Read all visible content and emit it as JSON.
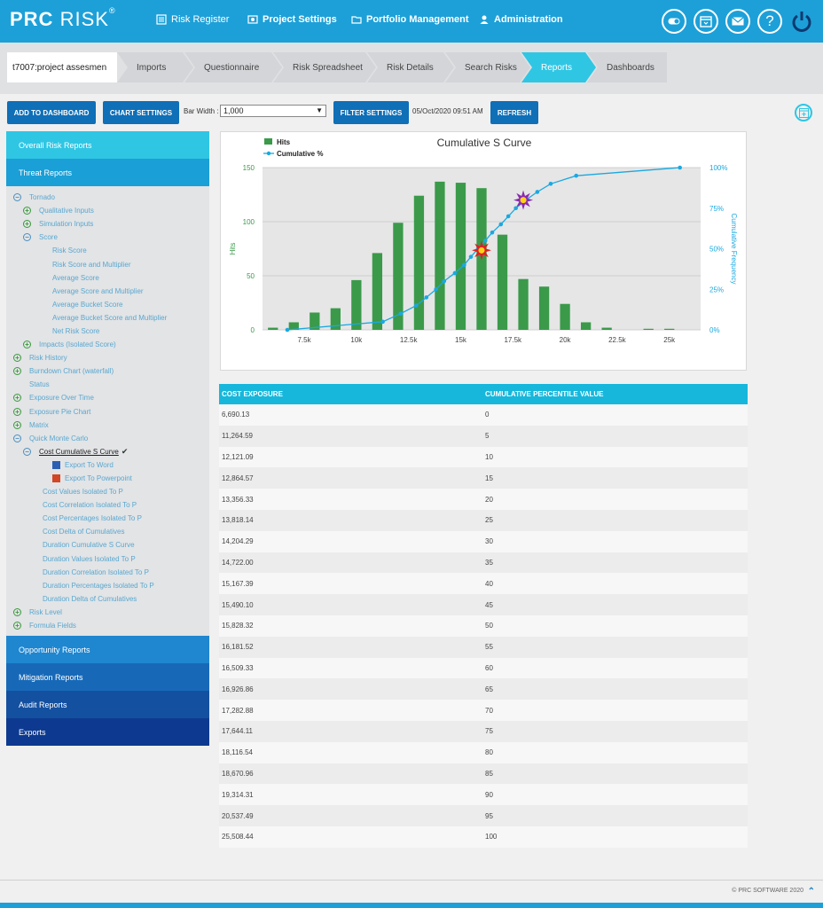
{
  "app": {
    "logo_bold": "PRC",
    "logo_light": "RISK",
    "logo_reg": "®"
  },
  "topnav": [
    {
      "label": "Risk Register",
      "icon": "list-icon"
    },
    {
      "label": "Project Settings",
      "icon": "settings-icon"
    },
    {
      "label": "Portfolio Management",
      "icon": "folder-icon"
    },
    {
      "label": "Administration",
      "icon": "user-icon"
    }
  ],
  "breadcrumb": {
    "project": "t7007:project assesmen",
    "steps": [
      "Imports",
      "Questionnaire",
      "Risk Spreadsheet",
      "Risk Details",
      "Search Risks",
      "Reports",
      "Dashboards"
    ],
    "active": "Reports"
  },
  "toolbar": {
    "add_dashboard": "ADD TO DASHBOARD",
    "chart_settings": "CHART SETTINGS",
    "bar_width_label": "Bar Width :",
    "bar_width_value": "1,000",
    "filter_settings": "FILTER SETTINGS",
    "datetime": "05/Oct/2020 09:51 AM",
    "refresh": "REFRESH"
  },
  "sidebar": {
    "overall": "Overall Risk Reports",
    "threat": "Threat Reports",
    "tree": [
      {
        "label": "Tornado",
        "level": 0,
        "icon": "minus"
      },
      {
        "label": "Qualitative Inputs",
        "level": 1,
        "icon": "plus"
      },
      {
        "label": "Simulation Inputs",
        "level": 1,
        "icon": "plus"
      },
      {
        "label": "Score",
        "level": 1,
        "icon": "minus"
      },
      {
        "label": "Risk Score",
        "level": 2,
        "icon": ""
      },
      {
        "label": "Risk Score and Multiplier",
        "level": 2,
        "icon": ""
      },
      {
        "label": "Average Score",
        "level": 2,
        "icon": ""
      },
      {
        "label": "Average Score and Multiplier",
        "level": 2,
        "icon": ""
      },
      {
        "label": "Average Bucket Score",
        "level": 2,
        "icon": ""
      },
      {
        "label": "Average Bucket Score and Multiplier",
        "level": 2,
        "icon": ""
      },
      {
        "label": "Net Risk Score",
        "level": 2,
        "icon": ""
      },
      {
        "label": "Impacts (Isolated Score)",
        "level": 1,
        "icon": "plus"
      },
      {
        "label": "Risk History",
        "level": 0,
        "icon": "plus"
      },
      {
        "label": "Burndown Chart (waterfall)",
        "level": 0,
        "icon": "plus"
      },
      {
        "label": "Status",
        "level": 0,
        "icon": ""
      },
      {
        "label": "Exposure Over Time",
        "level": 0,
        "icon": "plus"
      },
      {
        "label": "Exposure Pie Chart",
        "level": 0,
        "icon": "plus"
      },
      {
        "label": "Matrix",
        "level": 0,
        "icon": "plus"
      },
      {
        "label": "Quick Monte Carlo",
        "level": 0,
        "icon": "minus"
      },
      {
        "label": "Cost Cumulative S Curve",
        "level": 1,
        "icon": "minus",
        "selected": true
      },
      {
        "label": "Export To Word",
        "level": 2,
        "icon": "word"
      },
      {
        "label": "Export To Powerpoint",
        "level": 2,
        "icon": "ppt"
      },
      {
        "label": "Cost Values Isolated To P",
        "level": 1.5,
        "icon": ""
      },
      {
        "label": "Cost Correlation Isolated To P",
        "level": 1.5,
        "icon": ""
      },
      {
        "label": "Cost Percentages Isolated To P",
        "level": 1.5,
        "icon": ""
      },
      {
        "label": "Cost Delta of Cumulatives",
        "level": 1.5,
        "icon": ""
      },
      {
        "label": "Duration Cumulative S Curve",
        "level": 1.5,
        "icon": ""
      },
      {
        "label": "Duration Values Isolated To P",
        "level": 1.5,
        "icon": ""
      },
      {
        "label": "Duration Correlation Isolated To P",
        "level": 1.5,
        "icon": ""
      },
      {
        "label": "Duration Percentages Isolated To P",
        "level": 1.5,
        "icon": ""
      },
      {
        "label": "Duration Delta of Cumulatives",
        "level": 1.5,
        "icon": ""
      },
      {
        "label": "Risk Level",
        "level": 0,
        "icon": "plus"
      },
      {
        "label": "Formula Fields",
        "level": 0,
        "icon": "plus"
      }
    ],
    "sections": [
      {
        "label": "Opportunity Reports",
        "color": "#1f86d0"
      },
      {
        "label": "Mitigation Reports",
        "color": "#1769b8"
      },
      {
        "label": "Audit Reports",
        "color": "#1450a0"
      },
      {
        "label": "Exports",
        "color": "#0d3a90"
      }
    ]
  },
  "chart_data": {
    "type": "bar",
    "title": "Cumulative S Curve",
    "legend": [
      "Hits",
      "Cumulative %"
    ],
    "legend_position": "top-left",
    "ylabel": "Hits",
    "y2label": "Cumulative Frequency",
    "xticks": [
      "7.5k",
      "10k",
      "12.5k",
      "15k",
      "17.5k",
      "20k",
      "22.5k",
      "25k"
    ],
    "xtick_values": [
      7500,
      10000,
      12500,
      15000,
      17500,
      20000,
      22500,
      25000
    ],
    "yticks": [
      "0",
      "50",
      "100",
      "150"
    ],
    "y2ticks": [
      "0%",
      "25%",
      "50%",
      "75%",
      "100%"
    ],
    "xlim": [
      5500,
      26500
    ],
    "ylim": [
      0,
      150
    ],
    "y2lim": [
      0,
      100
    ],
    "grid": true,
    "bars": {
      "name": "Hits",
      "color": "#3a9a4a",
      "x": [
        6000,
        7000,
        8000,
        9000,
        10000,
        11000,
        12000,
        13000,
        14000,
        15000,
        16000,
        17000,
        18000,
        19000,
        20000,
        21000,
        22000,
        23000,
        24000,
        25000
      ],
      "values": [
        2,
        7,
        16,
        20,
        46,
        71,
        99,
        124,
        137,
        136,
        131,
        88,
        47,
        40,
        24,
        7,
        2,
        0,
        1,
        1
      ]
    },
    "line": {
      "name": "Cumulative %",
      "color": "#1ba8e0",
      "x": [
        6690,
        11265,
        12121,
        12865,
        13356,
        13818,
        14204,
        14722,
        15167,
        15490,
        15828,
        16182,
        16509,
        16927,
        17283,
        17644,
        18117,
        18671,
        19314,
        20537,
        25508
      ],
      "values": [
        0,
        5,
        10,
        15,
        20,
        25,
        30,
        35,
        40,
        45,
        50,
        55,
        60,
        65,
        70,
        75,
        80,
        85,
        90,
        95,
        100
      ]
    },
    "markers": [
      {
        "x": 16000,
        "pct": 49,
        "color": "#e02020"
      },
      {
        "x": 18000,
        "pct": 80,
        "color": "#8a2bb0"
      }
    ]
  },
  "table": {
    "headers": [
      "COST EXPOSURE",
      "CUMULATIVE PERCENTILE VALUE"
    ],
    "rows": [
      [
        "6,690.13",
        "0"
      ],
      [
        "11,264.59",
        "5"
      ],
      [
        "12,121.09",
        "10"
      ],
      [
        "12,864.57",
        "15"
      ],
      [
        "13,356.33",
        "20"
      ],
      [
        "13,818.14",
        "25"
      ],
      [
        "14,204.29",
        "30"
      ],
      [
        "14,722.00",
        "35"
      ],
      [
        "15,167.39",
        "40"
      ],
      [
        "15,490.10",
        "45"
      ],
      [
        "15,828.32",
        "50"
      ],
      [
        "16,181.52",
        "55"
      ],
      [
        "16,509.33",
        "60"
      ],
      [
        "16,926.86",
        "65"
      ],
      [
        "17,282.88",
        "70"
      ],
      [
        "17,644.11",
        "75"
      ],
      [
        "18,116.54",
        "80"
      ],
      [
        "18,670.96",
        "85"
      ],
      [
        "19,314.31",
        "90"
      ],
      [
        "20,537.49",
        "95"
      ],
      [
        "25,508.44",
        "100"
      ]
    ]
  },
  "footer": {
    "copyright": "© PRC SOFTWARE 2020",
    "up_arrow": "⌃"
  },
  "colors": {
    "topbar": "#1da0d8",
    "button": "#0f6fb7",
    "active_crumb": "#2fc6e4",
    "table_header": "#17b7dc"
  }
}
